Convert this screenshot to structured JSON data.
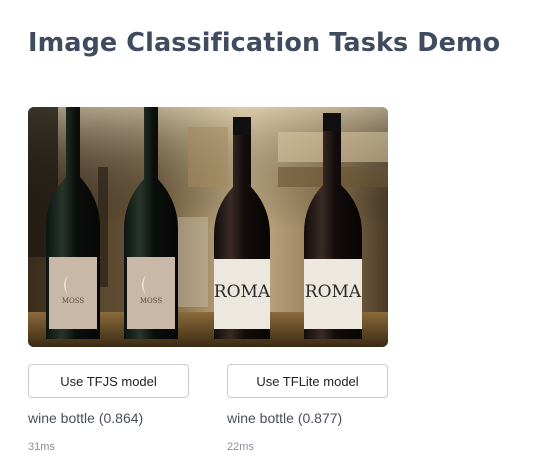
{
  "page": {
    "title": "Image Classification Tasks Demo"
  },
  "image": {
    "subject": "four wine bottles on a bar counter",
    "bottles": [
      {
        "label_text": "MOSS",
        "label_color": "#c9b7a7"
      },
      {
        "label_text": "MOSS",
        "label_color": "#c9b7a7"
      },
      {
        "label_text": "ROMA",
        "label_color": "#ece8df"
      },
      {
        "label_text": "ROMA",
        "label_color": "#ece8df"
      }
    ]
  },
  "panels": [
    {
      "button_label": "Use TFJS model",
      "result": "wine bottle (0.864)",
      "timing": "31ms"
    },
    {
      "button_label": "Use TFLite model",
      "result": "wine bottle (0.877)",
      "timing": "22ms"
    }
  ],
  "colors": {
    "title": "#3f4b5f",
    "button_border": "#c8ccd2",
    "result_text": "#4a4f57",
    "timing_text": "#8a8f97"
  }
}
